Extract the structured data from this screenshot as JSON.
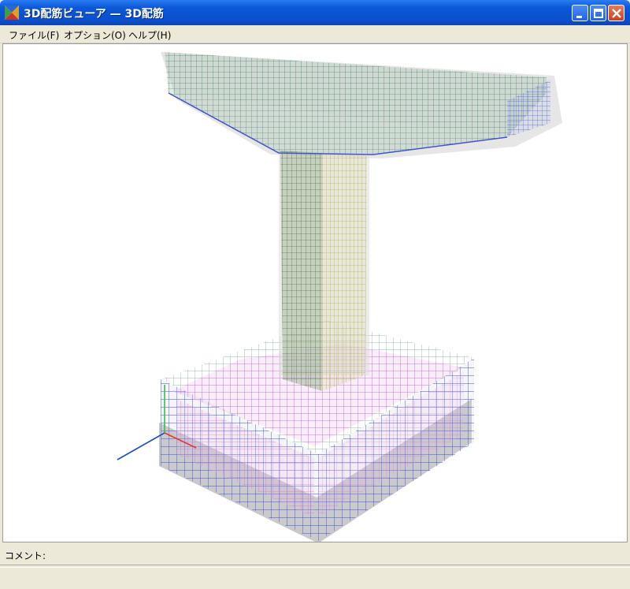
{
  "window": {
    "title": "3D配筋ビューア — 3D配筋",
    "controls": [
      "minimize",
      "maximize",
      "close"
    ]
  },
  "menu": {
    "items": [
      {
        "label": "ファイル(F)"
      },
      {
        "label": "オプション(O)"
      },
      {
        "label": "ヘルプ(H)"
      }
    ]
  },
  "viewport": {
    "description_icon": "3d-rebar-model",
    "colors": {
      "beam_mesh": "#4f8c6a",
      "column_mesh": "#c9c46a",
      "footing_mesh": "#d07ad6",
      "rebar_blue": "#3b4fd0",
      "concrete": "#c9c9c9",
      "axis_x": "#e23a2a",
      "axis_y": "#38c043",
      "axis_z": "#1d4fbf"
    }
  },
  "comment": {
    "label": "コメント:"
  }
}
